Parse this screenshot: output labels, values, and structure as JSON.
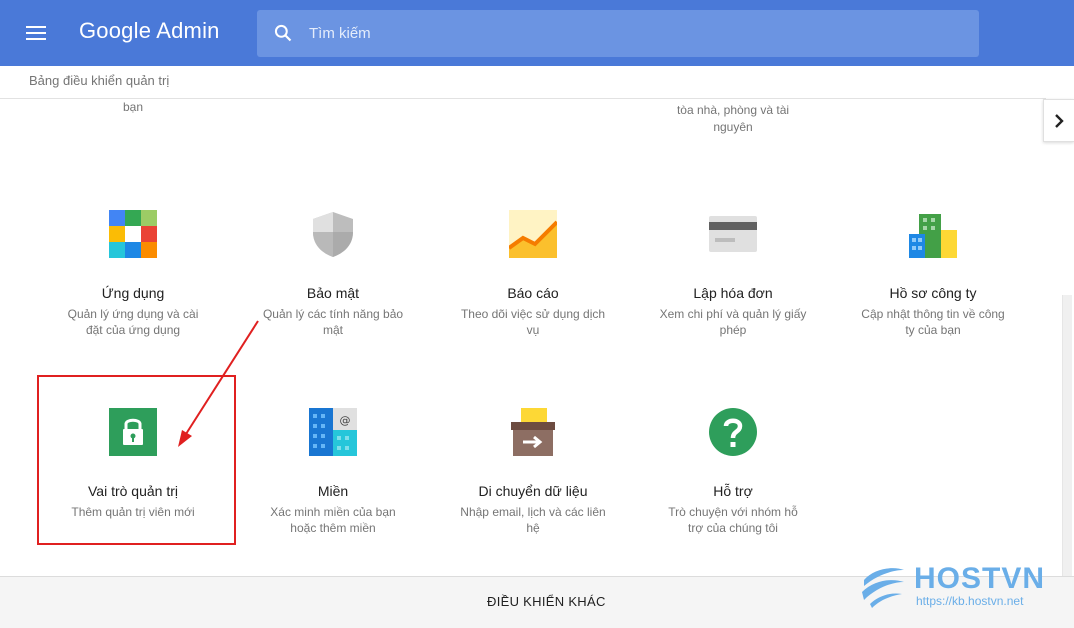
{
  "header": {
    "brand": "Google Admin",
    "search_placeholder": "Tìm kiếm"
  },
  "breadcrumb": "Bảng điều khiển quản trị",
  "partial_above": [
    {
      "text": "bạn"
    },
    {
      "text": "tòa nhà, phòng và tài nguyên"
    }
  ],
  "tiles": [
    {
      "title": "Ứng dụng",
      "desc": "Quản lý ứng dụng và cài đặt của ứng dụng",
      "icon": "apps-icon"
    },
    {
      "title": "Bảo mật",
      "desc": "Quản lý các tính năng bảo mật",
      "icon": "security-shield-icon"
    },
    {
      "title": "Báo cáo",
      "desc": "Theo dõi việc sử dụng dịch vụ",
      "icon": "reports-chart-icon"
    },
    {
      "title": "Lập hóa đơn",
      "desc": "Xem chi phí và quản lý giấy phép",
      "icon": "billing-card-icon"
    },
    {
      "title": "Hồ sơ công ty",
      "desc": "Cập nhật thông tin về công ty của bạn",
      "icon": "company-building-icon"
    },
    {
      "title": "Vai trò quản trị",
      "desc": "Thêm quản trị viên mới",
      "icon": "admin-lock-icon"
    },
    {
      "title": "Miền",
      "desc": "Xác minh miền của bạn hoặc thêm miền",
      "icon": "domains-icon"
    },
    {
      "title": "Di chuyển dữ liệu",
      "desc": "Nhập email, lịch và các liên hệ",
      "icon": "data-migration-icon"
    },
    {
      "title": "Hỗ trợ",
      "desc": "Trò chuyện với nhóm hỗ trợ của chúng tôi",
      "icon": "support-question-icon"
    }
  ],
  "footer": {
    "more_controls": "ĐIỀU KHIỂN KHÁC"
  },
  "watermark": {
    "name": "HOSTVN",
    "url": "https://kb.hostvn.net"
  },
  "colors": {
    "header": "#4a79d8",
    "search": "#6b94e2",
    "highlight": "#e02020"
  }
}
